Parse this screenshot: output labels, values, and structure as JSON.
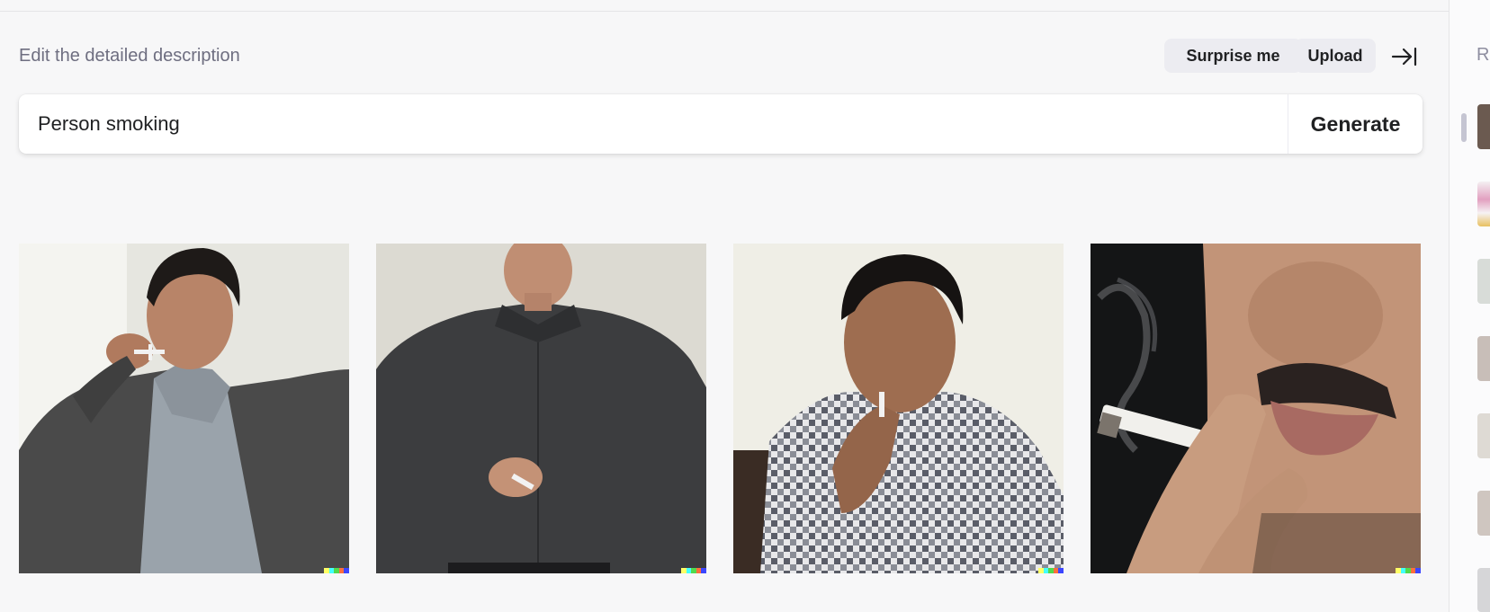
{
  "header": {
    "description_label": "Edit the detailed description",
    "surprise_label": "Surprise me",
    "upload_label": "Upload",
    "collapse_icon": "arrow-right-to-bar-icon"
  },
  "prompt": {
    "value": "Person smoking",
    "generate_label": "Generate"
  },
  "results": [
    {
      "alt": "Man in grey blazer bringing a cigarette to his lips"
    },
    {
      "alt": "Man in dark shirt holding a cigarette, looking down"
    },
    {
      "alt": "Man in checkered shirt with a cigarette in his mouth"
    },
    {
      "alt": "Close-up of a mouth smoking a cigarette"
    }
  ],
  "history_panel": {
    "title": "R"
  },
  "colors": {
    "background": "#f7f7f8",
    "pill": "#ececf1",
    "text": "#202123",
    "muted": "#6e6e80",
    "badge": [
      "#ffff66",
      "#42ffff",
      "#51da4c",
      "#ff6e3c",
      "#3c46ff"
    ]
  }
}
